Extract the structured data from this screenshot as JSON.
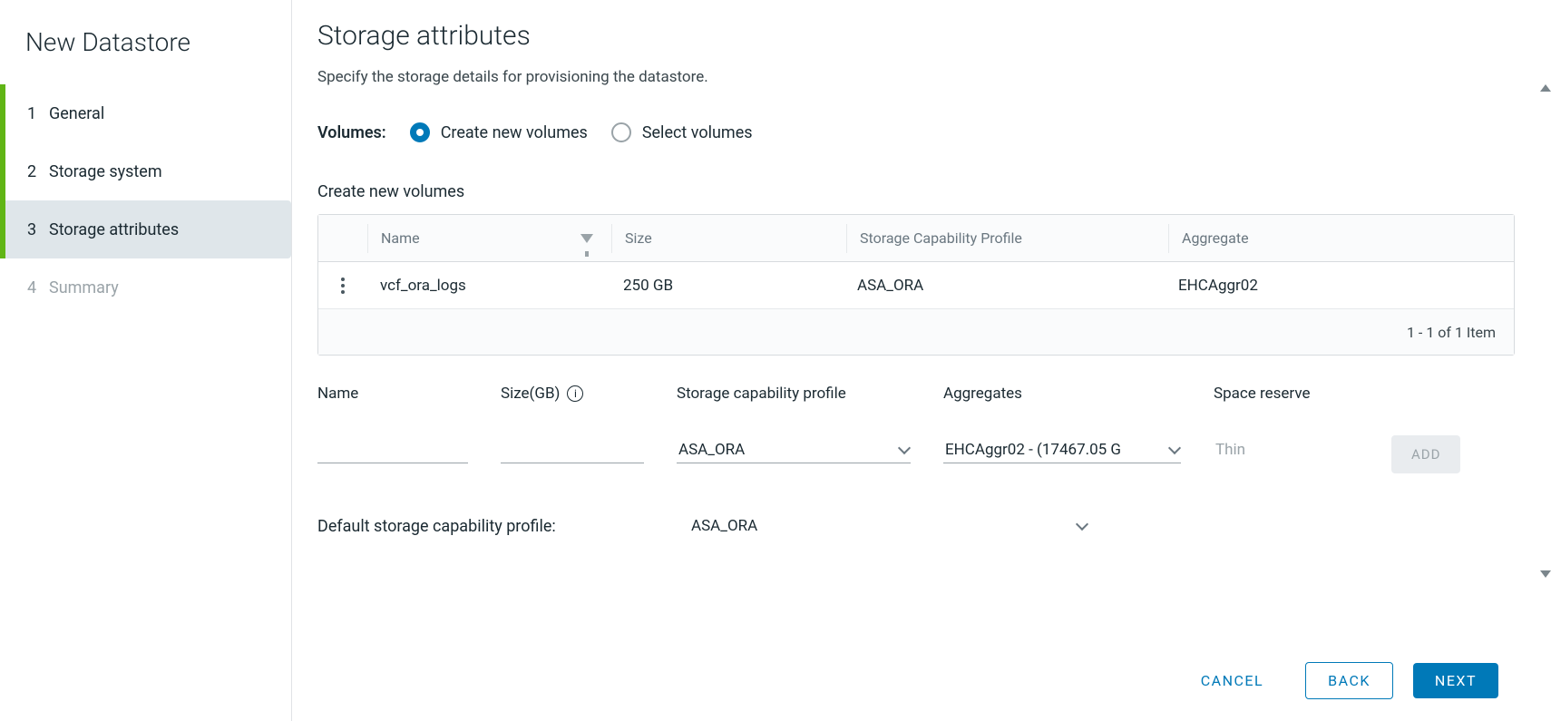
{
  "wizard": {
    "title": "New Datastore",
    "steps": [
      {
        "num": "1",
        "label": "General"
      },
      {
        "num": "2",
        "label": "Storage system"
      },
      {
        "num": "3",
        "label": "Storage attributes"
      },
      {
        "num": "4",
        "label": "Summary"
      }
    ]
  },
  "page": {
    "heading": "Storage attributes",
    "subtitle": "Specify the storage details for provisioning the datastore."
  },
  "volumes": {
    "label": "Volumes:",
    "create_label": "Create new volumes",
    "select_label": "Select volumes"
  },
  "create_section": {
    "title": "Create new volumes"
  },
  "table": {
    "headers": {
      "name": "Name",
      "size": "Size",
      "scp": "Storage Capability Profile",
      "aggr": "Aggregate"
    },
    "row": {
      "name": "vcf_ora_logs",
      "size": "250 GB",
      "scp": "ASA_ORA",
      "aggr": "EHCAggr02"
    },
    "footer": "1 - 1 of 1 Item"
  },
  "form": {
    "labels": {
      "name": "Name",
      "size": "Size(GB)",
      "scp": "Storage capability profile",
      "aggr": "Aggregates",
      "space": "Space reserve"
    },
    "values": {
      "scp": "ASA_ORA",
      "aggr": "EHCAggr02 - (17467.05 G",
      "space": "Thin"
    },
    "add": "ADD"
  },
  "default_profile": {
    "label": "Default storage capability profile:",
    "value": "ASA_ORA"
  },
  "footer": {
    "cancel": "CANCEL",
    "back": "BACK",
    "next": "NEXT"
  }
}
